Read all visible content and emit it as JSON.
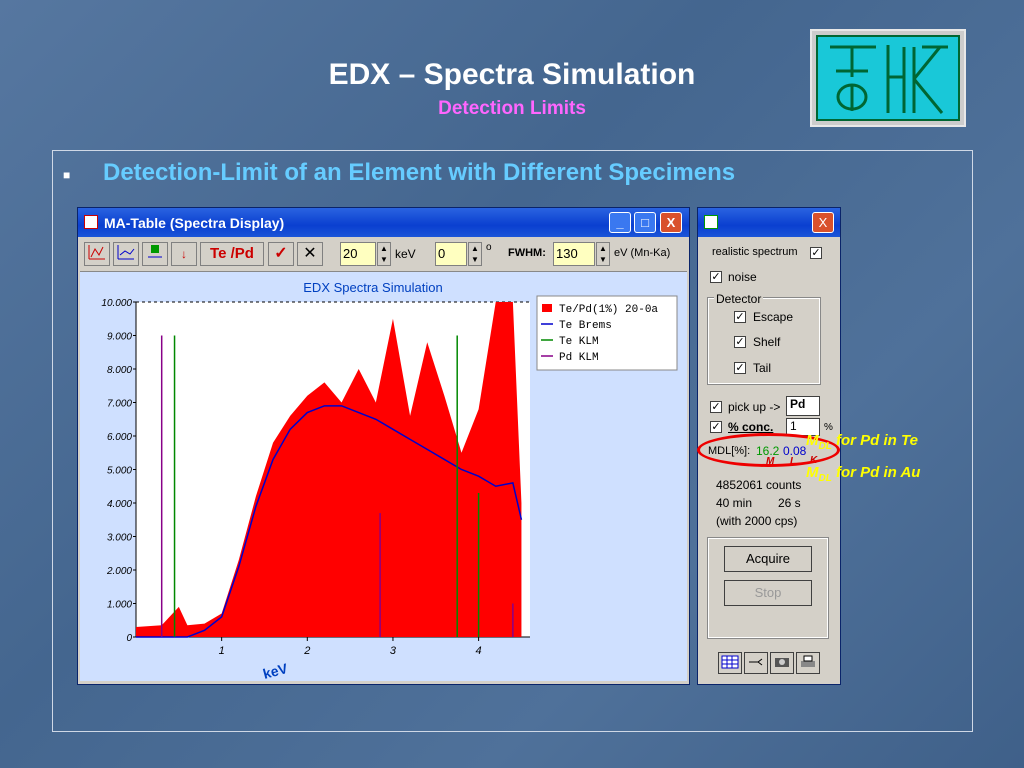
{
  "slide": {
    "title": "EDX – Spectra Simulation",
    "subtitle": "Detection Limits",
    "bullet": "■",
    "headline": "Detection-Limit of an Element with Different Specimens"
  },
  "window": {
    "title": "MA-Table (Spectra Display)",
    "minimize": "_",
    "maximize": "□",
    "close": "X"
  },
  "toolbar": {
    "elem_button": "Te /Pd",
    "ok": "✓",
    "cancel": "✕",
    "kev_value": "20",
    "kev_label": "keV",
    "deg_value": "0",
    "deg_label": "o",
    "fwhm_label": "FWHM:",
    "fwhm_value": "130",
    "fwhm_unit": "eV (Mn-Ka)",
    "arrow": "↓"
  },
  "chart_data": {
    "type": "area",
    "title": "EDX Spectra Simulation",
    "xlabel": "keV",
    "ylabel": "",
    "x_ticks": [
      "1",
      "2",
      "3",
      "4"
    ],
    "y_ticks": [
      "0",
      "1.000",
      "2.000",
      "3.000",
      "4.000",
      "5.000",
      "6.000",
      "7.000",
      "8.000",
      "9.000",
      "10.000"
    ],
    "xlim": [
      0,
      4.6
    ],
    "ylim": [
      0,
      10000
    ],
    "legend": [
      "Te/Pd(1%) 20-0a",
      "Te Brems",
      "Te KLM",
      "Pd KLM"
    ],
    "legend_position": "top-right",
    "series": [
      {
        "name": "Te/Pd(1%) 20-0a",
        "color": "#ff0000",
        "x": [
          0,
          0.3,
          0.5,
          0.6,
          0.8,
          1.0,
          1.2,
          1.4,
          1.6,
          1.8,
          2.0,
          2.2,
          2.4,
          2.6,
          2.8,
          3.0,
          3.2,
          3.4,
          3.6,
          3.8,
          4.0,
          4.2,
          4.4,
          4.5
        ],
        "y": [
          300,
          350,
          900,
          350,
          400,
          700,
          2300,
          4200,
          5800,
          6600,
          7200,
          7600,
          7000,
          8000,
          7000,
          9500,
          6600,
          8800,
          7200,
          5500,
          6800,
          10000,
          10000,
          4000
        ]
      },
      {
        "name": "Te Brems",
        "color": "#0000cc",
        "x": [
          0,
          0.6,
          0.8,
          1.0,
          1.2,
          1.4,
          1.6,
          1.8,
          2.0,
          2.2,
          2.4,
          2.6,
          2.8,
          3.0,
          3.2,
          3.4,
          3.6,
          3.8,
          4.0,
          4.2,
          4.4,
          4.5
        ],
        "y": [
          0,
          0,
          200,
          600,
          2100,
          3900,
          5300,
          6200,
          6700,
          6900,
          6900,
          6700,
          6500,
          6200,
          5900,
          5600,
          5300,
          5000,
          4800,
          4500,
          4600,
          3500
        ]
      },
      {
        "name": "Te KLM",
        "color": "#008800",
        "lines": [
          {
            "x": 0.45,
            "y": 9000
          },
          {
            "x": 3.75,
            "y": 9000
          },
          {
            "x": 4.0,
            "y": 4300
          }
        ]
      },
      {
        "name": "Pd KLM",
        "color": "#880088",
        "lines": [
          {
            "x": 0.3,
            "y": 9000
          },
          {
            "x": 2.85,
            "y": 3700
          },
          {
            "x": 4.4,
            "y": 1000
          }
        ]
      }
    ]
  },
  "panel": {
    "realistic": "realistic spectrum",
    "noise": "noise",
    "detector": "Detector",
    "escape": "Escape",
    "shelf": "Shelf",
    "tail": "Tail",
    "pickup": "pick up ->",
    "pickup_value": "Pd",
    "conc": "% conc.",
    "conc_value": "1",
    "pct": "%",
    "mdl_label": "MDL[%]:",
    "mdl_m": "16.2",
    "mdl_l": "0.08",
    "m": "M",
    "l": "L",
    "k": "K",
    "counts": "4852061 counts",
    "time_min": "40 min",
    "time_s": "26 s",
    "cps": "(with 2000 cps)",
    "acquire": "Acquire",
    "stop": "Stop",
    "check": "✓"
  },
  "annotations": {
    "a1_main": "M",
    "a1_sub": "DL",
    "a1_text": " for Pd in Te",
    "a2_main": "M",
    "a2_sub": "DL",
    "a2_text": " for Pd in Au"
  },
  "colors": {
    "accent": "#66ccff",
    "subtitle": "#ff66ff",
    "spectrum": "#ff0000",
    "annotation": "#ffff00"
  }
}
